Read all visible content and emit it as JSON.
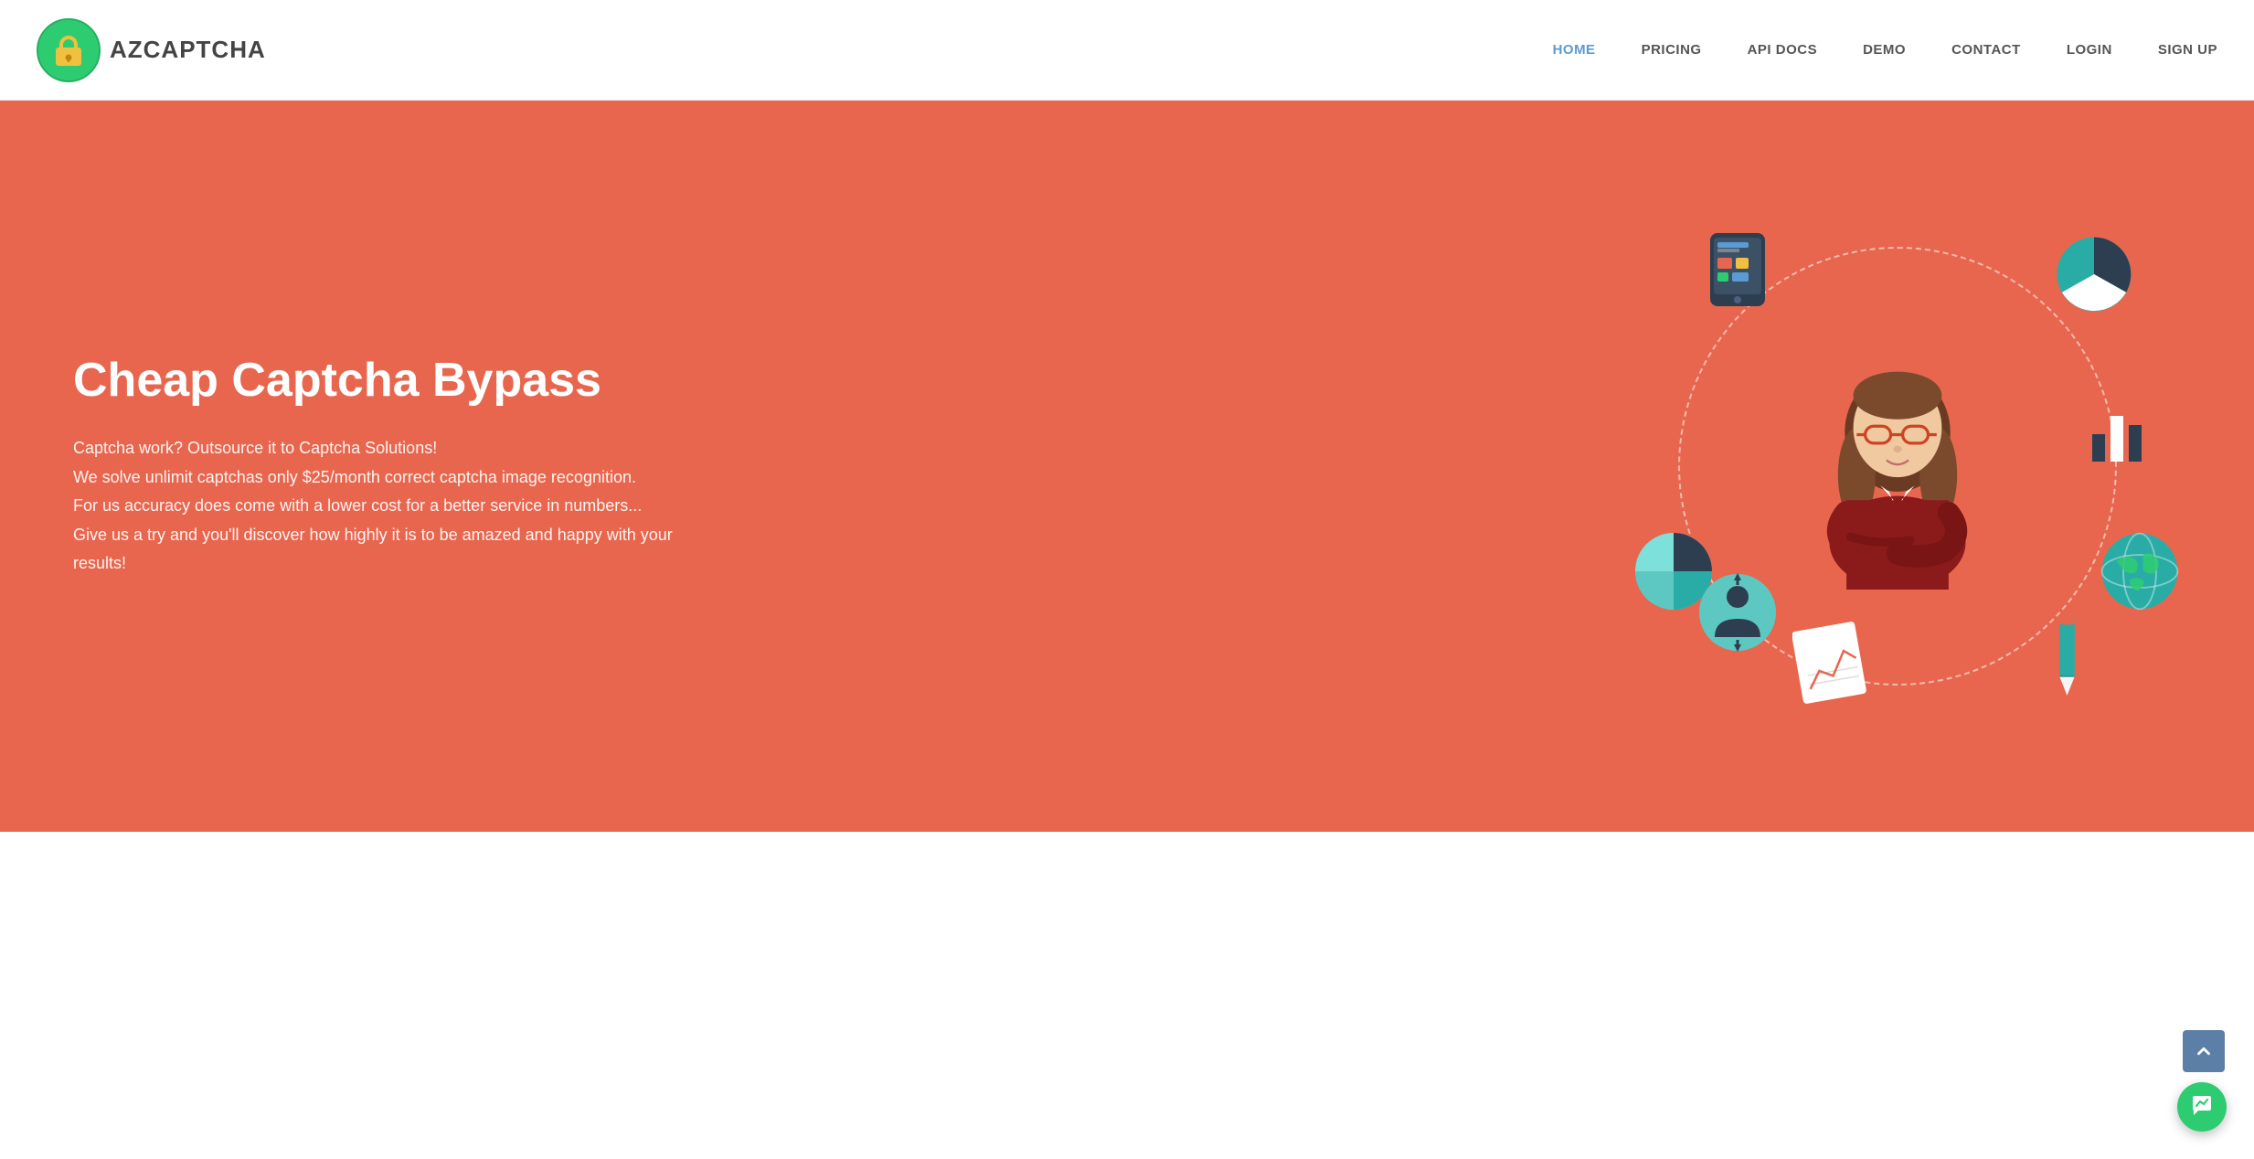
{
  "navbar": {
    "logo_text": "AZCAPTCHA",
    "links": [
      {
        "label": "HOME",
        "id": "home",
        "active": true
      },
      {
        "label": "PRICING",
        "id": "pricing",
        "active": false
      },
      {
        "label": "API DOCS",
        "id": "api-docs",
        "active": false
      },
      {
        "label": "DEMO",
        "id": "demo",
        "active": false
      },
      {
        "label": "CONTACT",
        "id": "contact",
        "active": false
      },
      {
        "label": "LOGIN",
        "id": "login",
        "active": false
      },
      {
        "label": "SIGN UP",
        "id": "signup",
        "active": false
      }
    ]
  },
  "hero": {
    "title": "Cheap Captcha Bypass",
    "desc_line1": "Captcha work? Outsource it to Captcha Solutions!",
    "desc_line2": "We solve unlimit captchas only $25/month correct captcha image recognition.",
    "desc_line3": "For us accuracy does come with a lower cost for a better service in numbers...",
    "desc_line4": "Give us a try and you'll discover how highly it is to be amazed and happy with your results!"
  },
  "colors": {
    "hero_bg": "#e8664e",
    "nav_active": "#5b9bd5",
    "fab_green": "#2ecc71",
    "scroll_blue": "#5b7fa6"
  }
}
